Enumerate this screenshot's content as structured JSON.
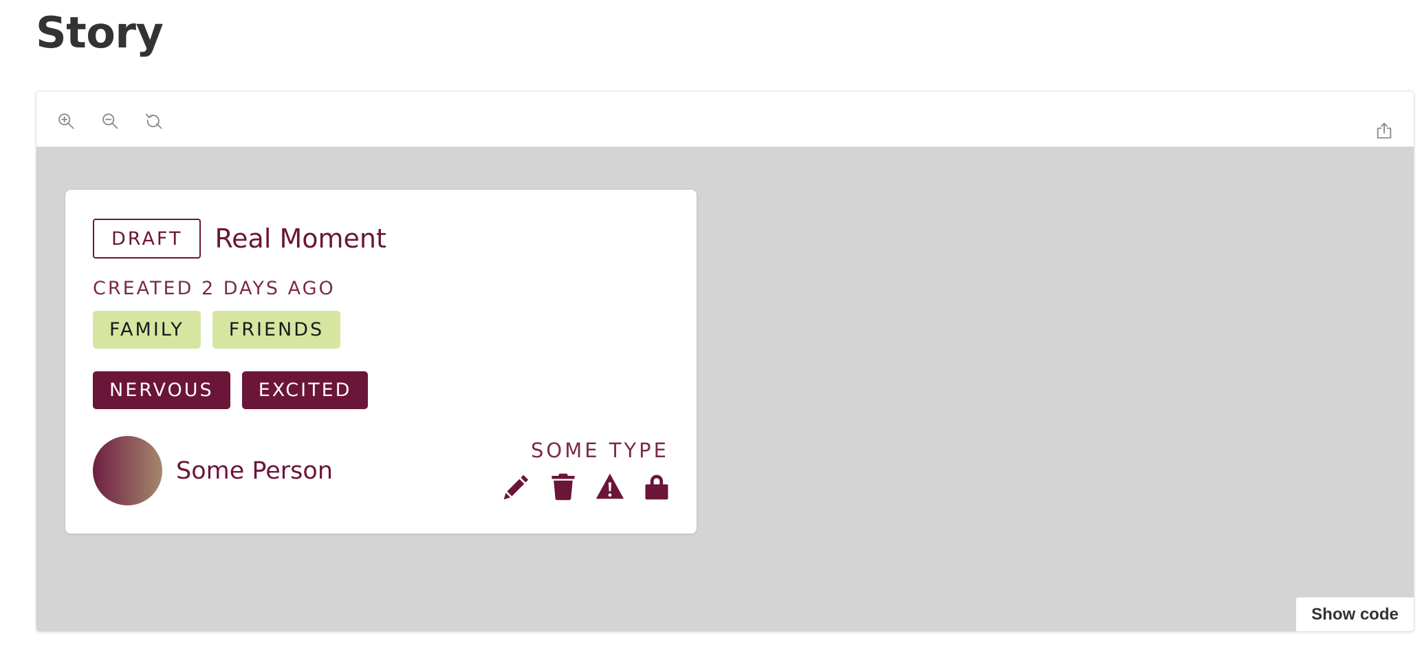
{
  "page": {
    "title": "Story"
  },
  "toolbar": {
    "zoom_in_icon": "zoom-in-icon",
    "zoom_out_icon": "zoom-out-icon",
    "reset_icon": "reset-zoom-icon",
    "share_icon": "share-icon"
  },
  "card": {
    "status": "DRAFT",
    "title": "Real Moment",
    "created": "CREATED 2 DAYS AGO",
    "topic_tags": [
      "FAMILY",
      "FRIENDS"
    ],
    "feeling_tags": [
      "NERVOUS",
      "EXCITED"
    ],
    "person_name": "Some Person",
    "type": "SOME TYPE",
    "actions": [
      "pencil-icon",
      "trash-icon",
      "warning-icon",
      "lock-icon"
    ]
  },
  "footer": {
    "show_code": "Show code"
  },
  "colors": {
    "accent": "#6b1538",
    "topic_tag_bg": "#d6e6a1",
    "canvas_bg": "#d4d4d4",
    "title_text": "#333333"
  }
}
